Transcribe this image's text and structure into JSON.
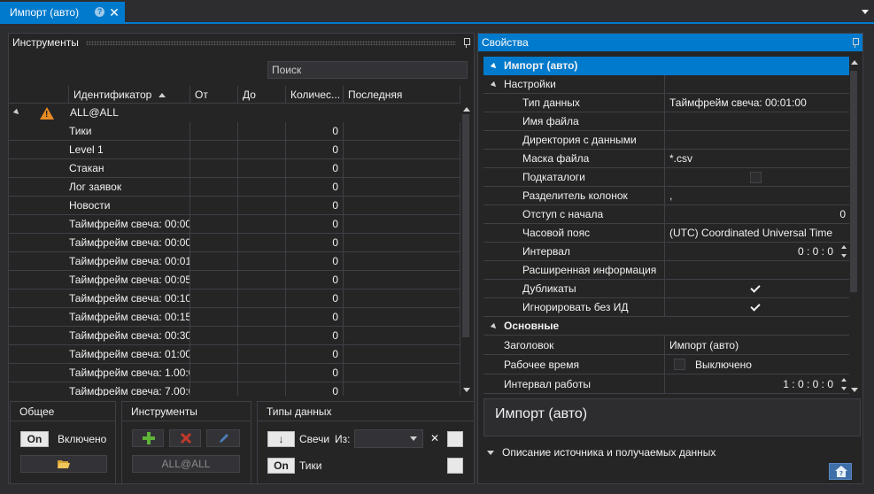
{
  "tab": {
    "title": "Импорт (авто)",
    "help": "?",
    "close": "✕"
  },
  "instruments_panel": {
    "title": "Инструменты",
    "search_placeholder": "Поиск",
    "columns": [
      "Идентификатор",
      "От",
      "До",
      "Количес...",
      "Последняя"
    ],
    "group_row": {
      "label": "ALL@ALL"
    },
    "rows": [
      {
        "id": "Тики",
        "count": "0"
      },
      {
        "id": "Level 1",
        "count": "0"
      },
      {
        "id": "Стакан",
        "count": "0"
      },
      {
        "id": "Лог заявок",
        "count": "0"
      },
      {
        "id": "Новости",
        "count": "0"
      },
      {
        "id": "Таймфрейм свеча: 00:00:",
        "count": "0"
      },
      {
        "id": "Таймфрейм свеча: 00:00:",
        "count": "0"
      },
      {
        "id": "Таймфрейм свеча: 00:01:",
        "count": "0"
      },
      {
        "id": "Таймфрейм свеча: 00:05:",
        "count": "0"
      },
      {
        "id": "Таймфрейм свеча: 00:10:",
        "count": "0"
      },
      {
        "id": "Таймфрейм свеча: 00:15:",
        "count": "0"
      },
      {
        "id": "Таймфрейм свеча: 00:30:",
        "count": "0"
      },
      {
        "id": "Таймфрейм свеча: 01:00:",
        "count": "0"
      },
      {
        "id": "Таймфрейм свеча: 1.00:0",
        "count": "0"
      },
      {
        "id": "Таймфрейм свеча: 7.00:0",
        "count": "0"
      }
    ]
  },
  "general_group": {
    "title": "Общее",
    "on_label": "On",
    "state_label": "Включено"
  },
  "tools_group": {
    "title": "Инструменты",
    "selected_label": "ALL@ALL"
  },
  "datatypes_group": {
    "title": "Типы данных",
    "rows": [
      {
        "toggle": "↓",
        "label": "Свечи",
        "from_label": "Из:",
        "close": "✕"
      },
      {
        "toggle": "On",
        "label": "Тики"
      }
    ]
  },
  "properties_panel": {
    "title": "Свойства",
    "header_row": "Импорт (авто)",
    "settings_category": "Настройки",
    "settings": [
      {
        "name": "Тип данных",
        "value": "Таймфрейм свеча: 00:01:00"
      },
      {
        "name": "Имя файла",
        "value": ""
      },
      {
        "name": "Директория с данными",
        "value": ""
      },
      {
        "name": "Маска файла",
        "value": "*.csv"
      },
      {
        "name": "Подкаталоги",
        "value": ""
      },
      {
        "name": "Разделитель колонок",
        "value": ","
      },
      {
        "name": "Отступ с начала",
        "value": "0"
      },
      {
        "name": "Часовой пояс",
        "value": "(UTC) Coordinated Universal Time"
      },
      {
        "name": "Интервал",
        "value": "0 : 0 : 0"
      },
      {
        "name": "Расширенная информация",
        "value": ""
      },
      {
        "name": "Дубликаты",
        "value": ""
      },
      {
        "name": "Игнорировать без ИД",
        "value": ""
      }
    ],
    "main_category": "Основные",
    "main": [
      {
        "name": "Заголовок",
        "value": "Импорт (авто)"
      },
      {
        "name": "Рабочее время",
        "value": "Выключено"
      },
      {
        "name": "Интервал работы",
        "value": "1 : 0 : 0 : 0"
      }
    ],
    "description_title": "Импорт (авто)",
    "description_toggle": "Описание источника и получаемых данных"
  },
  "colors": {
    "accent": "#007acc",
    "background": "#2d2d30",
    "panel": "#252526",
    "add_green": "#5fb336",
    "delete_red": "#c0392b",
    "warning": "#e58b23"
  }
}
